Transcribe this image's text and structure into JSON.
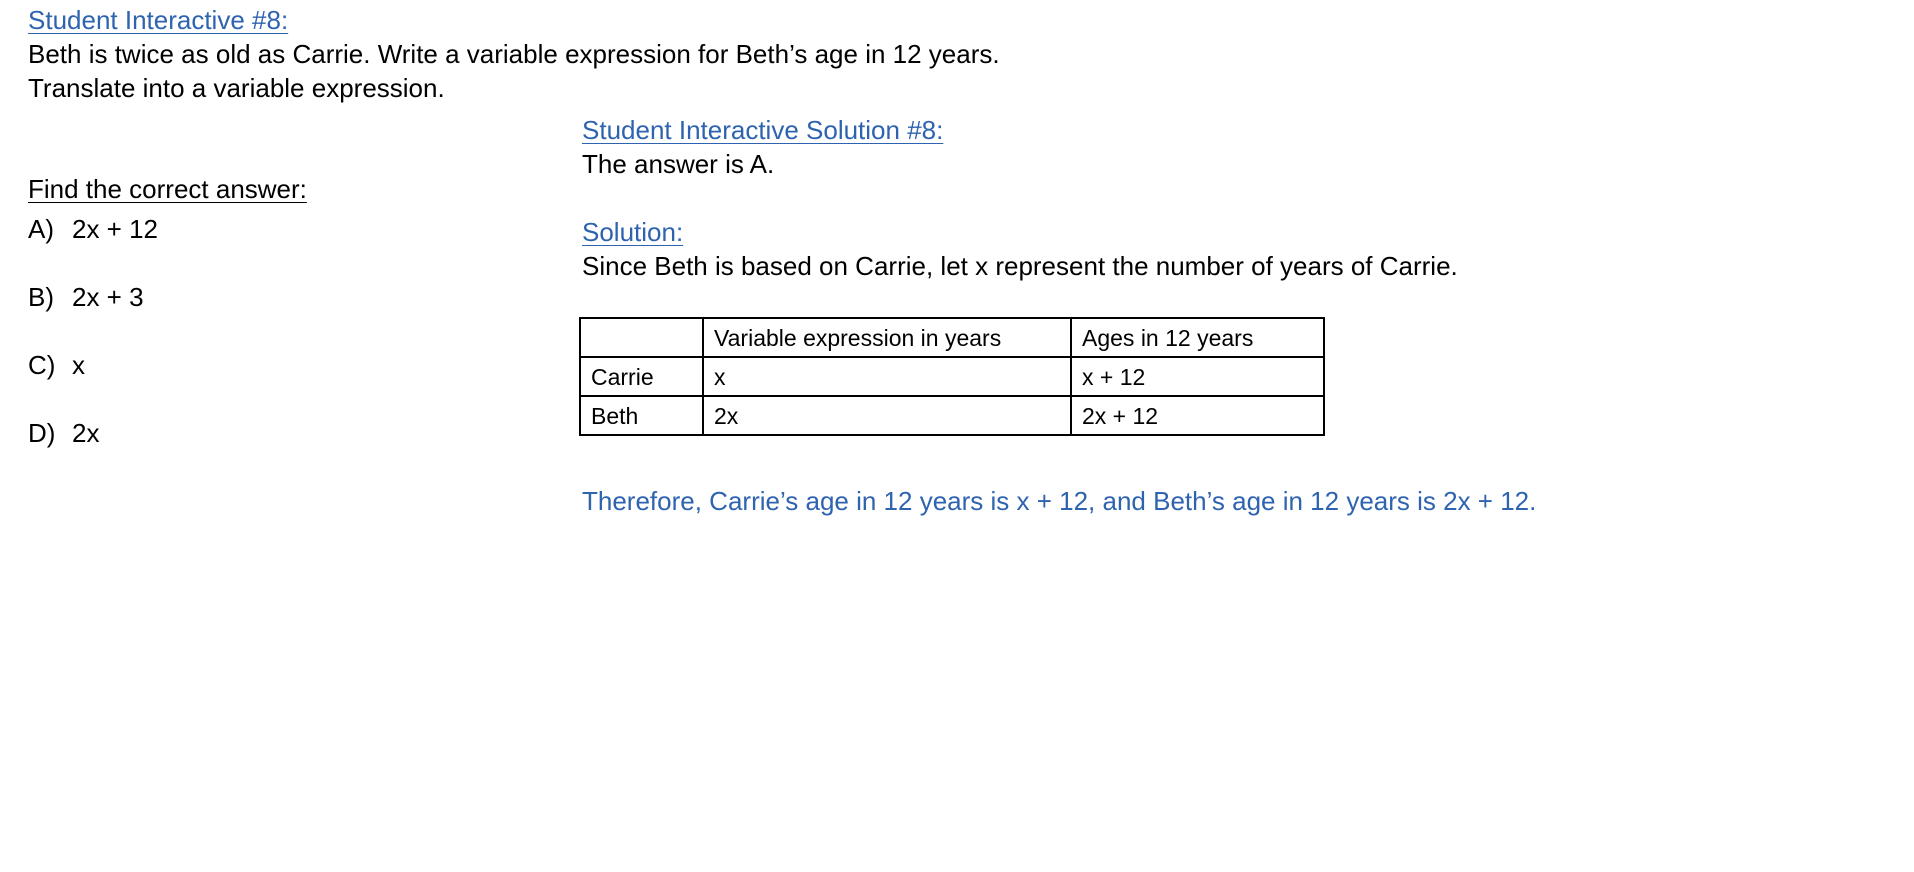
{
  "problem": {
    "heading": "Student Interactive #8:",
    "line1": "Beth is twice as old as Carrie.  Write a variable expression for Beth’s age in 12 years.",
    "line2": "Translate into a variable expression."
  },
  "choices": {
    "prompt": "Find the correct answer:",
    "items": [
      {
        "letter": "A)",
        "text": "2x + 12"
      },
      {
        "letter": "B)",
        "text": "2x + 3"
      },
      {
        "letter": "C)",
        "text": "x"
      },
      {
        "letter": "D)",
        "text": "2x"
      }
    ]
  },
  "solution": {
    "heading": "Student Interactive Solution #8:",
    "answer": "The answer is A.",
    "subheading": "Solution:",
    "explanation": "Since Beth is based on Carrie, let x represent the number of years of Carrie.",
    "table": {
      "headers": [
        "",
        "Variable expression in years",
        "Ages in 12 years"
      ],
      "rows": [
        [
          "Carrie",
          "x",
          "x + 12"
        ],
        [
          "Beth",
          "2x",
          "2x + 12"
        ]
      ]
    },
    "conclusion": "Therefore, Carrie’s age in 12 years is x + 12, and Beth’s age in 12 years is 2x + 12.",
    "conclusion_color": "#2e63b0"
  },
  "colors": {
    "link": "#2e63b0",
    "text": "#000000"
  }
}
